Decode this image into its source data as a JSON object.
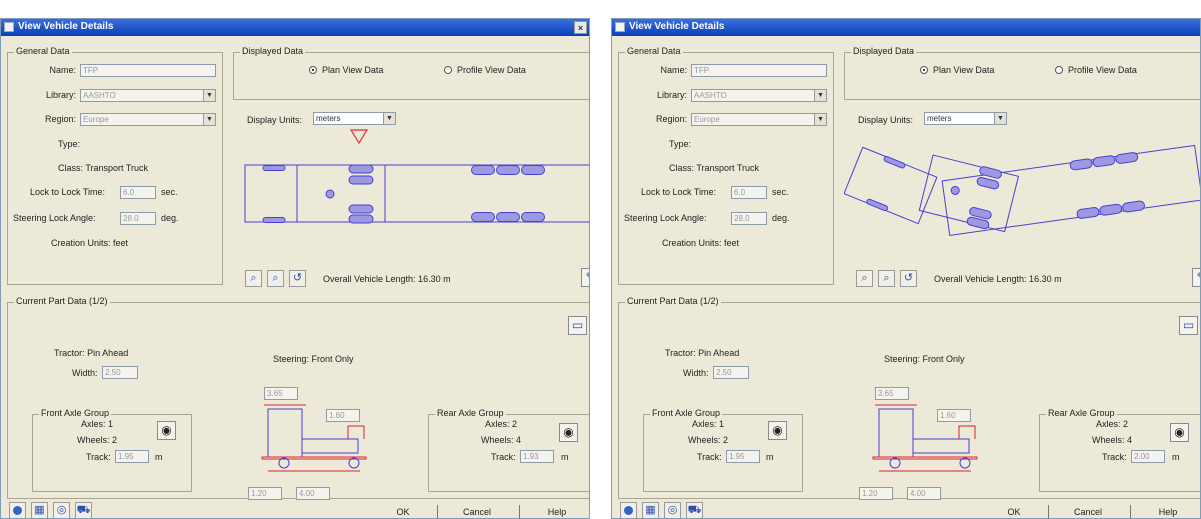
{
  "windows": [
    {
      "title": "View Vehicle Details",
      "close_glyph": "×",
      "general_legend": "General Data",
      "name_label": "Name:",
      "name_value": "TFP",
      "library_label": "Library:",
      "library_value": "AASHTO",
      "region_label": "Region:",
      "region_value": "Europe",
      "type_label": "Type:",
      "class_text": "Class: Transport Truck",
      "lock_label": "Lock to Lock Time:",
      "lock_value": "6.0",
      "lock_unit": "sec.",
      "steer_label": "Steering Lock Angle:",
      "steer_value": "28.0",
      "steer_unit": "deg.",
      "creation_text": "Creation Units: feet",
      "displayed_legend": "Displayed Data",
      "plan_label": "Plan View Data",
      "profile_label": "Profile View Data",
      "display_units_label": "Display Units:",
      "display_units_value": "meters",
      "overall_text": "Overall Vehicle Length: 16.30 m",
      "current_legend": "Current Part Data (1/2)",
      "tractor_text": "Tractor: Pin Ahead",
      "width_label": "Width:",
      "width_value": "2.50",
      "steering_text": "Steering: Front Only",
      "front_axle_legend": "Front Axle Group",
      "front_axles": "Axles: 1",
      "front_wheels": "Wheels: 2",
      "front_track_label": "Track:",
      "front_track_value": "1.95",
      "rear_axle_legend": "Rear Axle Group",
      "rear_axles": "Axles: 2",
      "rear_wheels": "Wheels: 4",
      "rear_track_label": "Track:",
      "rear_track_value": "1.93",
      "dim_top": "3.65",
      "dim_mid": "1.60",
      "dim_b1": "1.20",
      "dim_b2": "4.00",
      "track_unit": "m",
      "ok_label": "OK",
      "cancel_label": "Cancel",
      "help_label": "Help"
    },
    {
      "title": "View Vehicle Details",
      "close_glyph": "",
      "general_legend": "General Data",
      "name_label": "Name:",
      "name_value": "TFP",
      "library_label": "Library:",
      "library_value": "AASHTO",
      "region_label": "Region:",
      "region_value": "Europe",
      "type_label": "Type:",
      "class_text": "Class: Transport Truck",
      "lock_label": "Lock to Lock Time:",
      "lock_value": "6.0",
      "lock_unit": "sec.",
      "steer_label": "Steering Lock Angle:",
      "steer_value": "28.0",
      "steer_unit": "deg.",
      "creation_text": "Creation Units: feet",
      "displayed_legend": "Displayed Data",
      "plan_label": "Plan View Data",
      "profile_label": "Profile View Data",
      "display_units_label": "Display Units:",
      "display_units_value": "meters",
      "overall_text": "Overall Vehicle Length: 16.30 m",
      "current_legend": "Current Part Data (1/2)",
      "tractor_text": "Tractor: Pin Ahead",
      "width_label": "Width:",
      "width_value": "2.50",
      "steering_text": "Steering: Front Only",
      "front_axle_legend": "Front Axle Group",
      "front_axles": "Axles: 1",
      "front_wheels": "Wheels: 2",
      "front_track_label": "Track:",
      "front_track_value": "1.95",
      "rear_axle_legend": "Rear Axle Group",
      "rear_axles": "Axles: 2",
      "rear_wheels": "Wheels: 4",
      "rear_track_label": "Track:",
      "rear_track_value": "2.00",
      "dim_top": "3.65",
      "dim_mid": "1.60",
      "dim_b1": "1.20",
      "dim_b2": "4.00",
      "track_unit": "m",
      "ok_label": "OK",
      "cancel_label": "Cancel",
      "help_label": "Help"
    }
  ],
  "icons": {
    "title": "dialog-icon",
    "zoom_in": "zoom-in-icon",
    "zoom_out": "zoom-out-icon",
    "rotate": "rotate-icon",
    "edit": "edit-icon",
    "next_part": "next-part-icon",
    "tire": "tire-icon",
    "info": "info-icon",
    "grid": "grid-icon",
    "target": "target-icon",
    "truck": "truck-icon"
  },
  "colors": {
    "title_bar": "#1c50c8",
    "vehicle_outline": "#4a3fd0",
    "wheel_fill": "#9d98e2",
    "dimension_red": "#d8222a",
    "dialog_face": "#ece9d8"
  }
}
